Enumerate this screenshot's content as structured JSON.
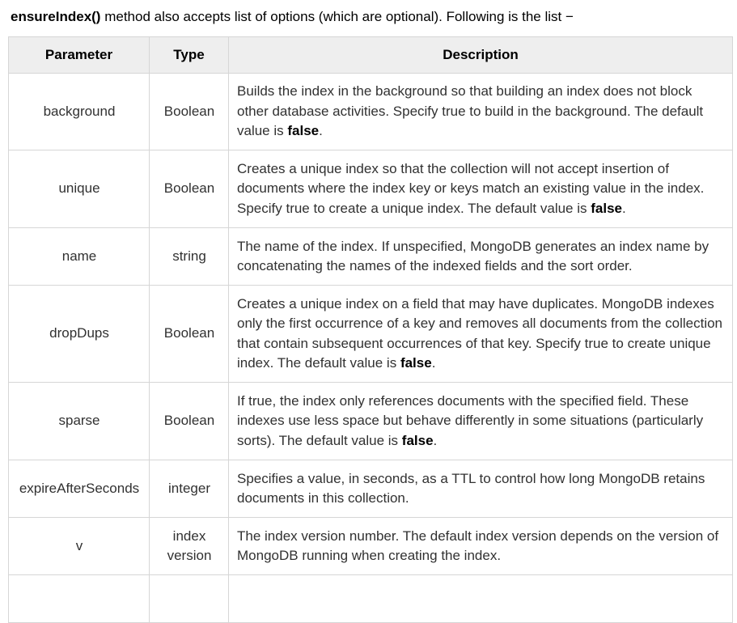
{
  "intro": {
    "method": "ensureIndex()",
    "text": " method also accepts list of options (which are optional). Following is the list −"
  },
  "table": {
    "headers": [
      "Parameter",
      "Type",
      "Description"
    ],
    "rows": [
      {
        "parameter": "background",
        "type": "Boolean",
        "description": "Builds the index in the background so that building an index does not block other database activities. Specify true to build in the background. The default value is ",
        "default": "false",
        "suffix": "."
      },
      {
        "parameter": "unique",
        "type": "Boolean",
        "description": "Creates a unique index so that the collection will not accept insertion of documents where the index key or keys match an existing value in the index. Specify true to create a unique index. The default value is ",
        "default": "false",
        "suffix": "."
      },
      {
        "parameter": "name",
        "type": "string",
        "description": "The name of the index. If unspecified, MongoDB generates an index name by concatenating the names of the indexed fields and the sort order.",
        "default": "",
        "suffix": ""
      },
      {
        "parameter": "dropDups",
        "type": "Boolean",
        "description": "Creates a unique index on a field that may have duplicates. MongoDB indexes only the first occurrence of a key and removes all documents from the collection that contain subsequent occurrences of that key. Specify true to create unique index. The default value is ",
        "default": "false",
        "suffix": "."
      },
      {
        "parameter": "sparse",
        "type": "Boolean",
        "description": "If true, the index only references documents with the specified field. These indexes use less space but behave differently in some situations (particularly sorts). The default value is ",
        "default": "false",
        "suffix": "."
      },
      {
        "parameter": "expireAfterSeconds",
        "type": "integer",
        "description": "Specifies a value, in seconds, as a TTL to control how long MongoDB retains documents in this collection.",
        "default": "",
        "suffix": ""
      },
      {
        "parameter": "v",
        "type": "index version",
        "description": "The index version number. The default index version depends on the version of MongoDB running when creating the index.",
        "default": "",
        "suffix": ""
      }
    ]
  }
}
